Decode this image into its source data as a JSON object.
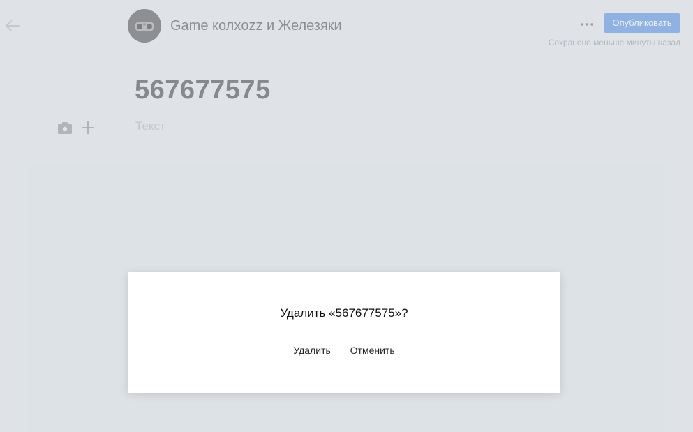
{
  "header": {
    "channel_name": "Game колxozz и Железяки",
    "publish_label": "Опубликовать",
    "saved_status": "Сохранено меньше минуты назад"
  },
  "editor": {
    "title": "567677575",
    "text_placeholder": "Текст"
  },
  "dialog": {
    "question": "Удалить «567677575»?",
    "confirm_label": "Удалить",
    "cancel_label": "Отменить"
  },
  "colors": {
    "background": "#dfe3e7",
    "publish_button": "#8fb2e2",
    "modal_background": "#ffffff"
  },
  "icons": [
    "back-arrow-icon",
    "more-dots-icon",
    "camera-icon",
    "plus-icon",
    "channel-avatar"
  ]
}
